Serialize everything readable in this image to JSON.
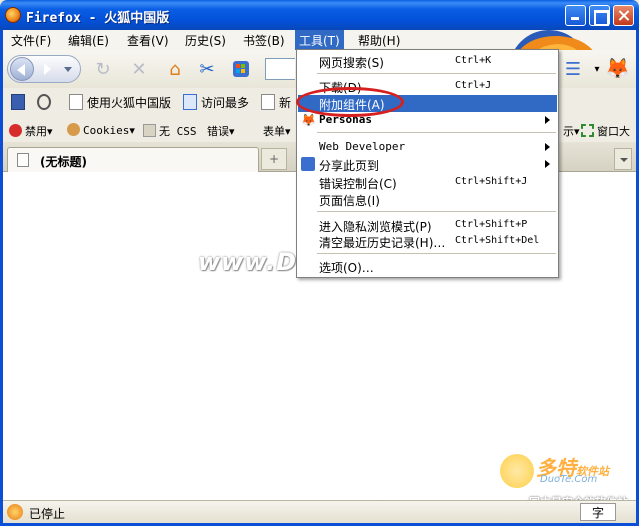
{
  "window": {
    "title": "Firefox - 火狐中国版",
    "minimize": "minimize",
    "maximize": "maximize",
    "close": "close"
  },
  "menubar": [
    {
      "label": "文件(F)"
    },
    {
      "label": "编辑(E)"
    },
    {
      "label": "查看(V)"
    },
    {
      "label": "历史(S)"
    },
    {
      "label": "书签(B)"
    },
    {
      "label": "工具(T)"
    },
    {
      "label": "帮助(H)"
    }
  ],
  "bookmarks": [
    {
      "label": "使用火狐中国版"
    },
    {
      "label": "访问最多"
    },
    {
      "label": "新"
    }
  ],
  "devbar": {
    "disable": "禁用",
    "cookies": "Cookies",
    "css": "无 CSS",
    "errors": "错误",
    "forms": "表单",
    "right_tail": "示",
    "window_size": "窗口大"
  },
  "tab": {
    "title": "(无标题)",
    "new_tab": "+"
  },
  "tools_menu": {
    "items": [
      {
        "label": "网页搜索(S)",
        "accel": "Ctrl+K"
      },
      {
        "label": "下载(D)",
        "accel": "Ctrl+J"
      },
      {
        "label": "附加组件(A)",
        "accel": "",
        "highlighted": true
      },
      {
        "label": "Personas",
        "accel": "",
        "submenu": true
      },
      {
        "label": "Web Developer",
        "accel": "",
        "submenu": true
      },
      {
        "label": "分享此页到",
        "accel": "",
        "submenu": true
      },
      {
        "label": "错误控制台(C)",
        "accel": "Ctrl+Shift+J"
      },
      {
        "label": "页面信息(I)",
        "accel": ""
      },
      {
        "label": "进入隐私浏览模式(P)",
        "accel": "Ctrl+Shift+P"
      },
      {
        "label": "清空最近历史记录(H)…",
        "accel": "Ctrl+Shift+Del"
      },
      {
        "label": "选项(O)…",
        "accel": ""
      }
    ]
  },
  "content": {
    "watermark": "www.DuoTe.com"
  },
  "brand": {
    "name_cn": "多特",
    "name_suffix": "软件站",
    "name_en": "DuoTe.Com",
    "tagline": "国内最安全的软件站"
  },
  "statusbar": {
    "text": "已停止",
    "ime": "字"
  },
  "colors": {
    "titlebar": "#0250d8",
    "highlight": "#316ac5",
    "annotation_circle": "#d6201f"
  }
}
